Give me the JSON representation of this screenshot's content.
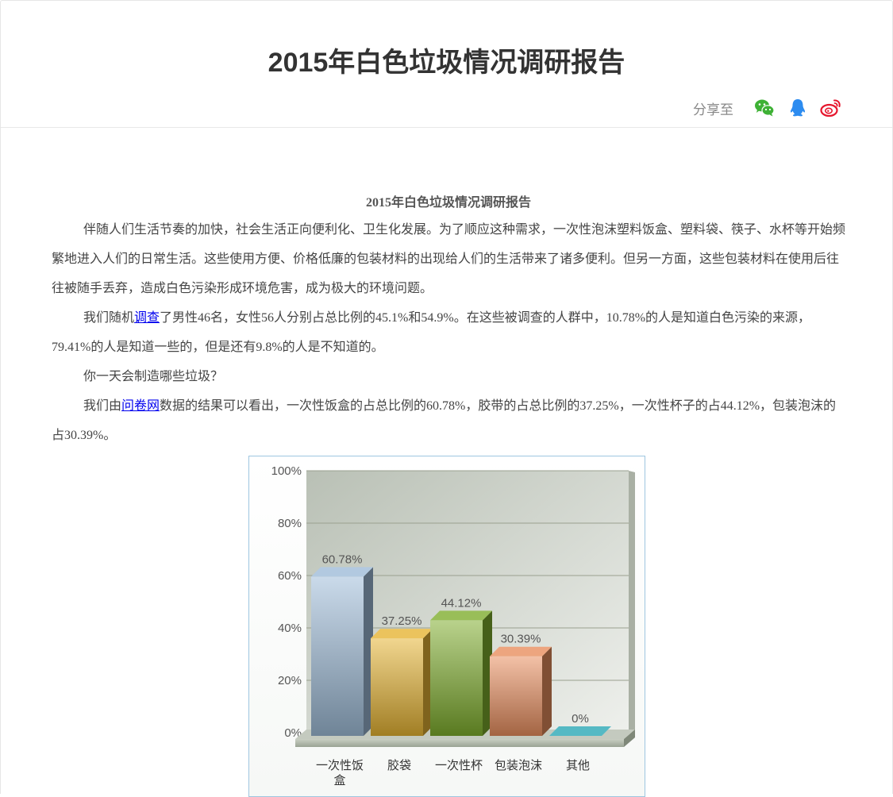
{
  "header": {
    "title": "2015年白色垃圾情况调研报告",
    "share_label": "分享至",
    "share_icons": [
      "wechat-icon",
      "qq-icon",
      "weibo-icon"
    ],
    "colors": {
      "wechat": "#3eb135",
      "qq": "#2d8cf0",
      "weibo": "#e6162d"
    }
  },
  "article": {
    "title": "2015年白色垃圾情况调研报告",
    "p1": "伴随人们生活节奏的加快，社会生活正向便利化、卫生化发展。为了顺应这种需求，一次性泡沫塑料饭盒、塑料袋、筷子、水杯等开始频繁地进入人们的日常生活。这些使用方便、价格低廉的包装材料的出现给人们的生活带来了诸多便利。但另一方面，这些包装材料在使用后往往被随手丢弃，造成白色污染形成环境危害，成为极大的环境问题。",
    "p2_before": "我们随机",
    "p2_link": "调查",
    "p2_after": "了男性46名，女性56人分别占总比例的45.1%和54.9%。在这些被调查的人群中，10.78%的人是知道白色污染的来源，79.41%的人是知道一些的，但是还有9.8%的人是不知道的。",
    "p3": "你一天会制造哪些垃圾？",
    "p4_before": "我们由",
    "p4_link": "问卷网",
    "p4_after": "数据的结果可以看出，一次性饭盒的占总比例的60.78%，胶带的占总比例的37.25%，一次性杯子的占44.12%，包装泡沫的占30.39%。"
  },
  "chart_data": {
    "type": "bar",
    "categories": [
      "一次性饭盒",
      "胶袋",
      "一次性杯",
      "包装泡沫",
      "其他"
    ],
    "values": [
      60.78,
      37.25,
      44.12,
      30.39,
      0
    ],
    "data_labels": [
      "60.78%",
      "37.25%",
      "44.12%",
      "30.39%",
      "0%"
    ],
    "yticks": [
      "0%",
      "20%",
      "40%",
      "60%",
      "80%",
      "100%"
    ],
    "ylim": [
      0,
      100
    ],
    "grid": true,
    "bar_colors": [
      "#9fbcd8",
      "#e6b434",
      "#7fae2e",
      "#e98f5f",
      "#2aa7b5"
    ]
  }
}
